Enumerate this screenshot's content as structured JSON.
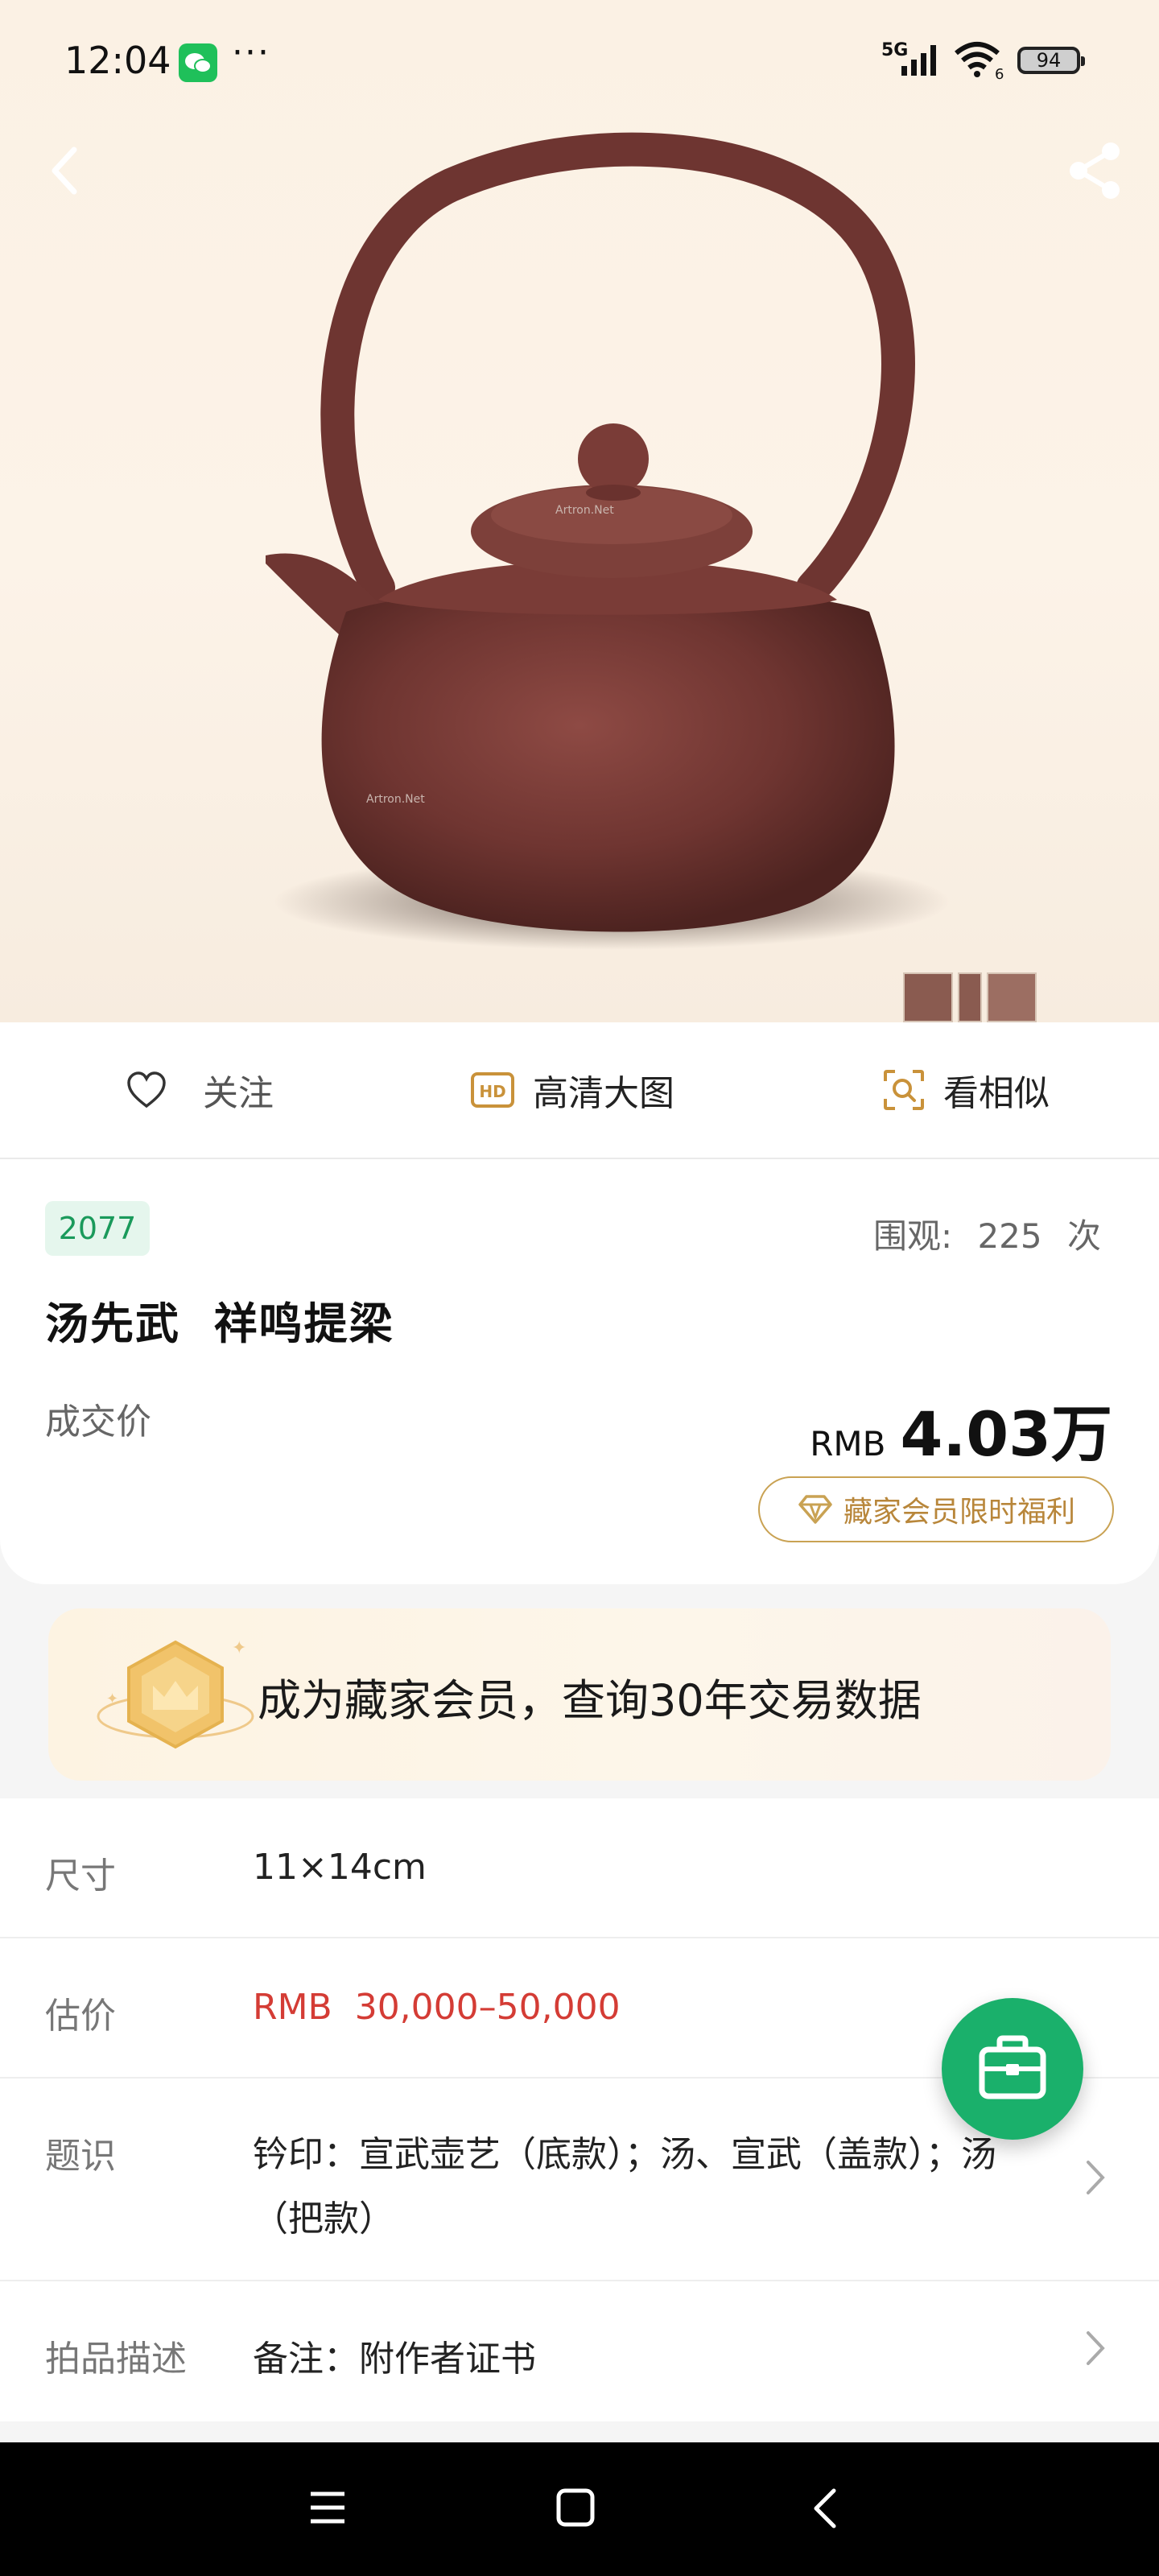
{
  "status_bar": {
    "time": "12:04",
    "dots": "···",
    "network": "5G",
    "wifi_sub": "6",
    "battery": "94"
  },
  "hero": {
    "watermark_1": "Artron.Net",
    "watermark_2": "Artron.Net",
    "icons": {
      "back": "back-arrow-icon",
      "share": "share-icon"
    }
  },
  "actions": {
    "follow": "关注",
    "hd": "高清大图",
    "hd_badge": "HD",
    "similar": "看相似"
  },
  "lot": {
    "number": "2077",
    "views_label": "围观:",
    "views_count": "225",
    "views_unit": "次",
    "title": "汤先武  祥鸣提梁",
    "price_label": "成交价",
    "price_currency": "RMB",
    "price_value": "4.03万",
    "member_benefit": "藏家会员限时福利"
  },
  "banner": {
    "text": "成为藏家会员，查询30年交易数据"
  },
  "details": [
    {
      "label": "尺寸",
      "value": "11×14cm"
    },
    {
      "label": "估价",
      "value": "RMB  30,000–50,000"
    },
    {
      "label": "题识",
      "value_line1": "钤印：宣武壶艺（底款）；汤、宣武（盖款）；汤",
      "value_line2": "（把款）"
    },
    {
      "label": "拍品描述",
      "value": "备注：附作者证书"
    }
  ],
  "colors": {
    "accent_green": "#1ab06b",
    "price_red": "#d43c35",
    "gold": "#c9a253"
  }
}
